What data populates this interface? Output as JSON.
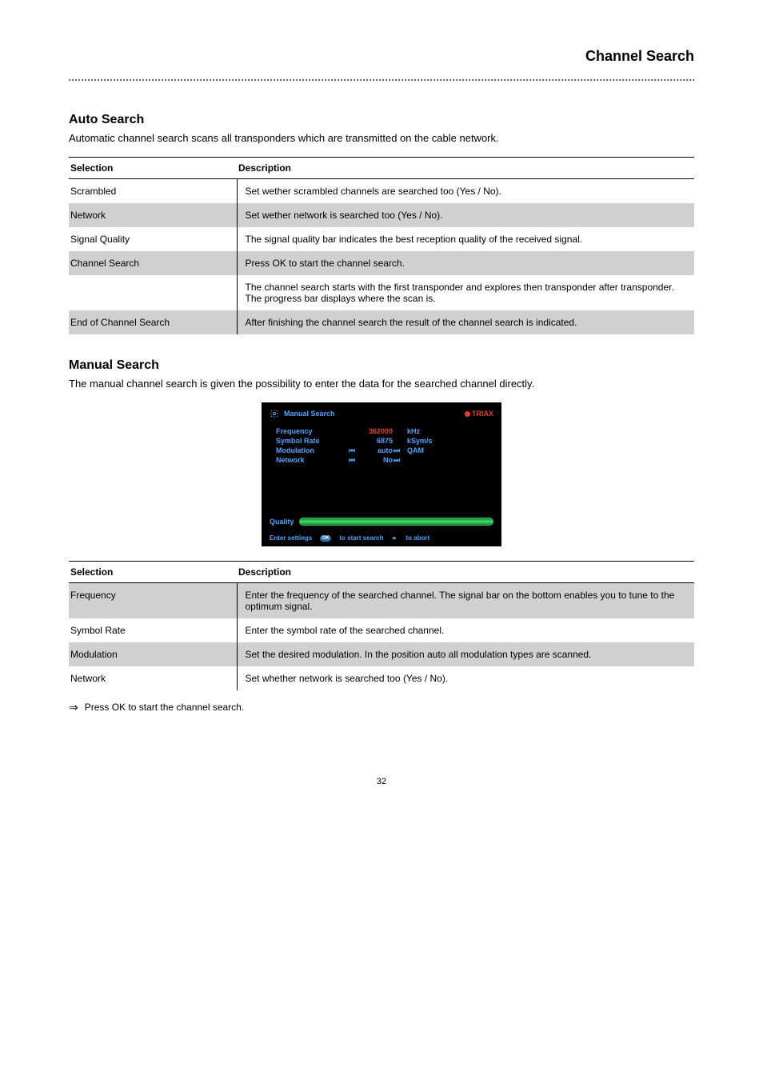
{
  "header": "Channel Search",
  "auto": {
    "title": "Auto Search",
    "sub": "Automatic channel search scans all transponders which are transmitted on the cable network.",
    "headers": [
      "Selection",
      "Description"
    ],
    "rows": [
      {
        "label": "Scrambled",
        "desc": "Set wether scrambled channels are searched too (Yes / No)."
      },
      {
        "label": "Network",
        "desc": "Set wether network is searched too (Yes / No)."
      },
      {
        "label": "Signal Quality",
        "desc": "The signal quality bar indicates the best reception quality of the received signal."
      },
      {
        "label": "Channel Search",
        "desc": "Press OK to start the channel search."
      },
      {
        "label": "",
        "desc": "The channel search starts with the first transponder and explores then transponder after transponder. The progress bar displays where the scan is."
      },
      {
        "label": "End of Channel Search",
        "desc": "After finishing the channel search the result of the channel search is indicated."
      }
    ]
  },
  "manual": {
    "title": "Manual Search",
    "sub": "The manual channel search is given the possibility to enter the data for the searched channel directly.",
    "osd": {
      "title": "Manual Search",
      "brand": "TRIAX",
      "rows": [
        {
          "label": "Frequency",
          "value": "362000",
          "unit": "kHz",
          "selected": true,
          "arrows": false
        },
        {
          "label": "Symbol Rate",
          "value": "6875",
          "unit": "kSym/s",
          "arrows": false
        },
        {
          "label": "Modulation",
          "value": "auto",
          "unit": "QAM",
          "arrows": true
        },
        {
          "label": "Network",
          "value": "No",
          "unit": "",
          "arrows": true
        }
      ],
      "quality_label": "Quality",
      "footer": {
        "enter": "Enter settings",
        "ok": "OK",
        "start": "to start search",
        "abort": "to abort"
      }
    },
    "headers": [
      "Selection",
      "Description"
    ],
    "rows": [
      {
        "label": "Frequency",
        "desc": "Enter the frequency of the searched channel. The signal bar on the bottom enables you to tune to the optimum signal."
      },
      {
        "label": "Symbol Rate",
        "desc": "Enter the symbol rate of the searched channel."
      },
      {
        "label": "Modulation",
        "desc": "Set the desired modulation. In the position auto all modulation types are scanned."
      },
      {
        "label": "Network",
        "desc": "Set whether network is searched too (Yes / No)."
      }
    ],
    "note": "Press OK to start the channel search."
  },
  "page_number": "32"
}
